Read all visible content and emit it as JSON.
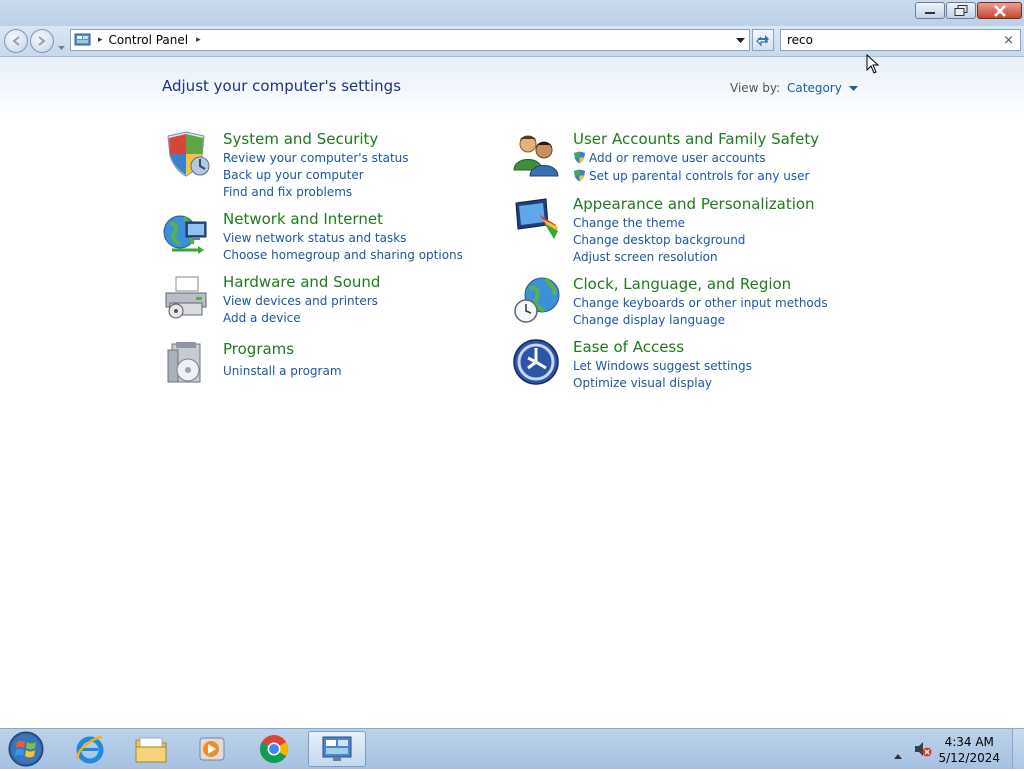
{
  "window": {
    "minimize_glyph": "—",
    "maximize_glyph": "❐",
    "close_glyph": "✕"
  },
  "address": {
    "crumb": "Control Panel",
    "sep_glyph": "▸"
  },
  "search": {
    "value": "reco",
    "clear_glyph": "×"
  },
  "header": {
    "title": "Adjust your computer's settings",
    "view_by_label": "View by:",
    "view_by_value": "Category"
  },
  "categories": [
    {
      "title": "System and Security",
      "icon": "shield-icon",
      "links": [
        "Review your computer's status",
        "Back up your computer",
        "Find and fix problems"
      ]
    },
    {
      "title": "Network and Internet",
      "icon": "network-globe-icon",
      "links": [
        "View network status and tasks",
        "Choose homegroup and sharing options"
      ]
    },
    {
      "title": "Hardware and Sound",
      "icon": "printer-icon",
      "links": [
        "View devices and printers",
        "Add a device"
      ]
    },
    {
      "title": "Programs",
      "icon": "programs-icon",
      "links": [
        "Uninstall a program"
      ]
    },
    {
      "title": "User Accounts and Family Safety",
      "icon": "users-icon",
      "links": [
        "Add or remove user accounts",
        "Set up parental controls for any user"
      ]
    },
    {
      "title": "Appearance and Personalization",
      "icon": "monitor-paint-icon",
      "links": [
        "Change the theme",
        "Change desktop background",
        "Adjust screen resolution"
      ]
    },
    {
      "title": "Clock, Language, and Region",
      "icon": "globe-clock-icon",
      "links": [
        "Change keyboards or other input methods",
        "Change display language"
      ]
    },
    {
      "title": "Ease of Access",
      "icon": "ease-of-access-icon",
      "links": [
        "Let Windows suggest settings",
        "Optimize visual display"
      ]
    }
  ],
  "taskbar": {
    "time": "4:34 AM",
    "date": "5/12/2024"
  },
  "colors": {
    "link": "#1e56a6",
    "category_title": "#1e7a1e",
    "heading": "#1e3287"
  }
}
